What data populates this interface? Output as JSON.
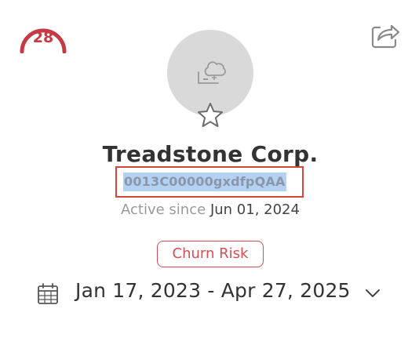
{
  "score": {
    "value": "28",
    "color": "#c73a45"
  },
  "header": {
    "share_icon": "share-icon"
  },
  "account": {
    "avatar_icon": "cloud-computer-icon",
    "favorite_icon": "star-outline-icon",
    "name": "Treadstone Corp.",
    "id": "0013C00000gxdfpQAA",
    "active_since_label": "Active since",
    "active_since_date": "Jun 01, 2024",
    "status_badge": "Churn Risk",
    "status_color": "#d84c55"
  },
  "date_range": {
    "icon": "calendar-icon",
    "value": "Jan 17, 2023 - Apr 27, 2025",
    "dropdown_icon": "chevron-down-icon"
  },
  "colors": {
    "highlight_border": "#d6453a",
    "selection": "#b4d1f2"
  }
}
